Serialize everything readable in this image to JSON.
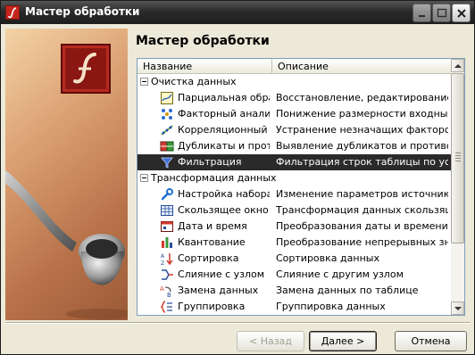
{
  "window": {
    "title": "Мастер обработки"
  },
  "titlebar_buttons": [
    "minimize-icon",
    "maximize-icon",
    "close-icon"
  ],
  "page": {
    "heading": "Мастер обработки"
  },
  "list": {
    "columns": [
      "Название",
      "Описание"
    ],
    "rows": [
      {
        "type": "group",
        "label": "Очистка данных",
        "expanded": true
      },
      {
        "type": "item",
        "icon": "partial-processing-icon",
        "name": "Парциальная обработка",
        "desc": "Восстановление, редактирование, сглаживание"
      },
      {
        "type": "item",
        "icon": "factor-analysis-icon",
        "name": "Факторный анализ",
        "desc": "Понижение размерности входных факторов"
      },
      {
        "type": "item",
        "icon": "correlation-analysis-icon",
        "name": "Корреляционный анализ",
        "desc": "Устранение незначащих факторов"
      },
      {
        "type": "item",
        "icon": "duplicates-icon",
        "name": "Дубликаты и противоречия",
        "desc": "Выявление дубликатов и противоречий"
      },
      {
        "type": "item",
        "icon": "filter-icon",
        "name": "Фильтрация",
        "desc": "Фильтрация строк таблицы по условию",
        "selected": true
      },
      {
        "type": "group",
        "label": "Трансформация данных",
        "expanded": true
      },
      {
        "type": "item",
        "icon": "dataset-settings-icon",
        "name": "Настройка набора данных",
        "desc": "Изменение параметров источника данных"
      },
      {
        "type": "item",
        "icon": "sliding-window-icon",
        "name": "Скользящее окно",
        "desc": "Трансформация данных скользящим окном"
      },
      {
        "type": "item",
        "icon": "date-time-icon",
        "name": "Дата и время",
        "desc": "Преобразования даты и времени"
      },
      {
        "type": "item",
        "icon": "quantization-icon",
        "name": "Квантование",
        "desc": "Преобразование непрерывных значений"
      },
      {
        "type": "item",
        "icon": "sort-icon",
        "name": "Сортировка",
        "desc": "Сортировка данных"
      },
      {
        "type": "item",
        "icon": "merge-icon",
        "name": "Слияние с узлом",
        "desc": "Слияние с другим узлом"
      },
      {
        "type": "item",
        "icon": "replace-data-icon",
        "name": "Замена данных",
        "desc": "Замена данных по таблице"
      },
      {
        "type": "item",
        "icon": "grouping-icon",
        "name": "Группировка",
        "desc": "Группировка данных"
      }
    ]
  },
  "buttons": {
    "back": "< Назад",
    "next": "Далее >",
    "cancel": "Отмена"
  },
  "colors": {
    "selection": "#2a2a2a",
    "brand_red": "#8a1712"
  }
}
